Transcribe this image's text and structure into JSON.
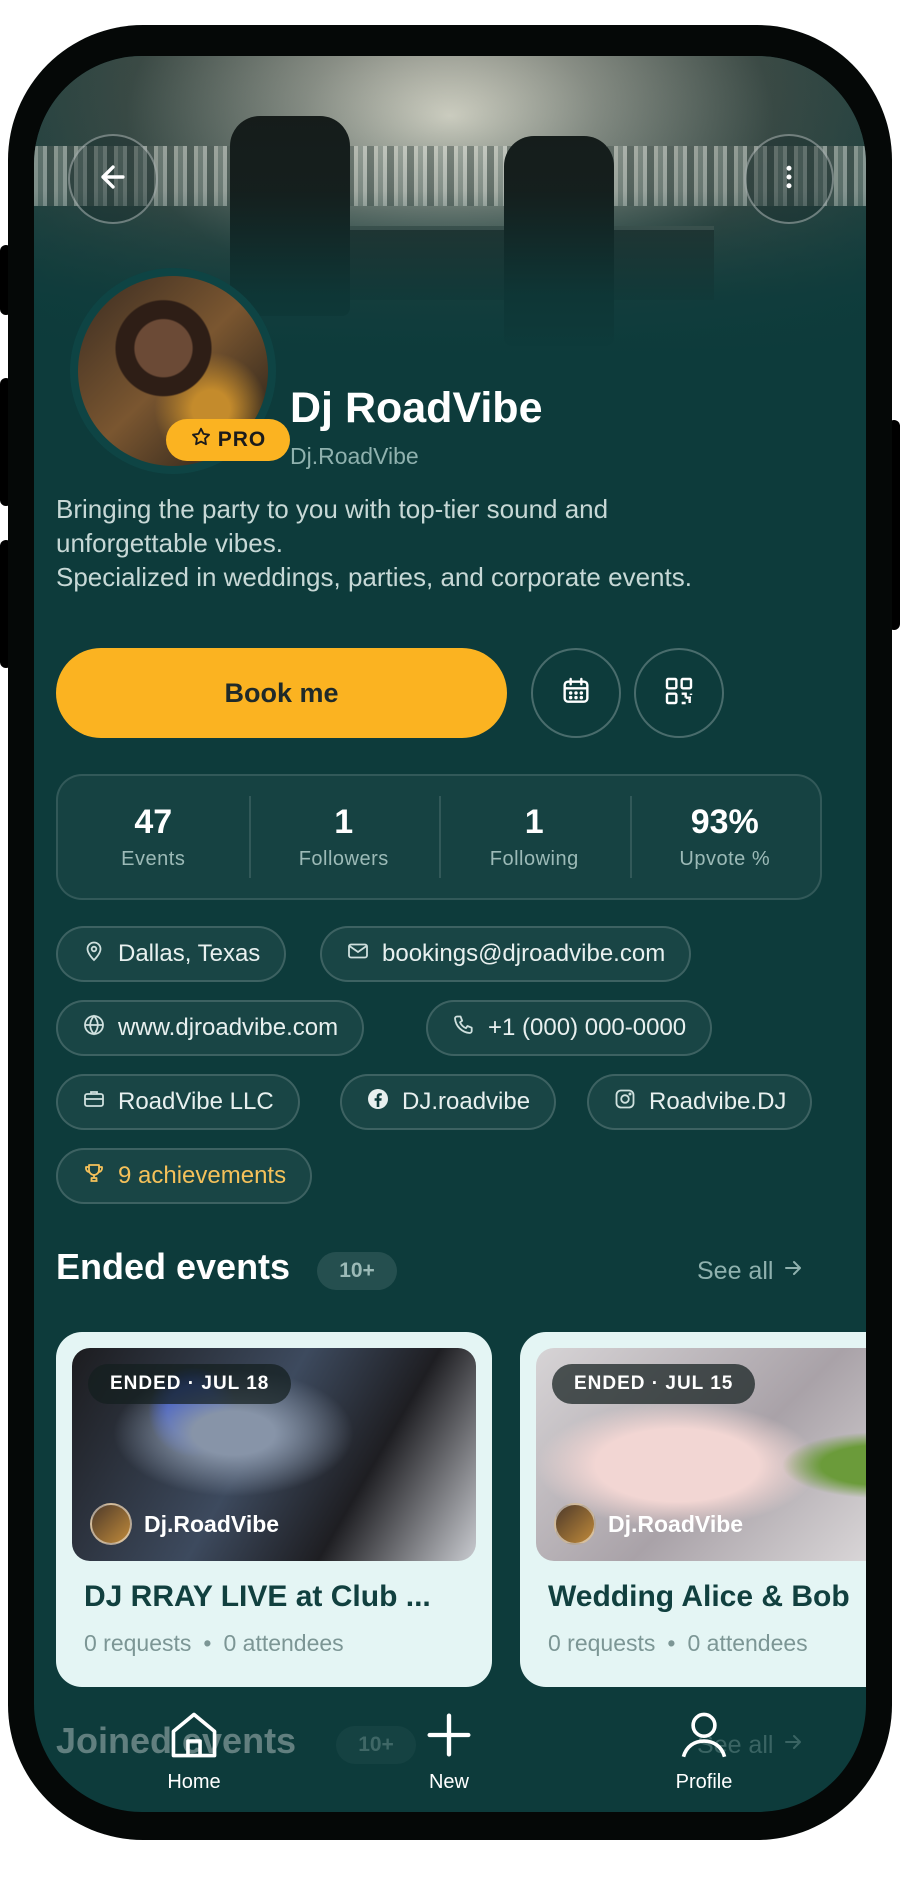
{
  "header": {
    "back_icon": "arrow-left-icon",
    "more_icon": "more-vertical-icon"
  },
  "profile": {
    "badge": "PRO",
    "name": "Dj RoadVibe",
    "handle": "Dj.RoadVibe",
    "bio_lines": [
      "Bringing the party to you with top-tier sound and",
      "unforgettable vibes.",
      "Specialized in weddings, parties, and corporate events."
    ]
  },
  "actions": {
    "book_label": "Book me",
    "calendar_icon": "calendar-icon",
    "qr_icon": "qr-code-icon"
  },
  "stats": [
    {
      "value": "47",
      "label": "Events"
    },
    {
      "value": "1",
      "label": "Followers"
    },
    {
      "value": "1",
      "label": "Following"
    },
    {
      "value": "93%",
      "label": "Upvote %"
    }
  ],
  "chips": {
    "location": "Dallas, Texas",
    "email": "bookings@djroadvibe.com",
    "website": "www.djroadvibe.com",
    "phone": "+1 (000) 000-0000",
    "company": "RoadVibe LLC",
    "facebook": "DJ.roadvibe",
    "instagram": "Roadvibe.DJ",
    "achievements": "9 achievements"
  },
  "ended_events": {
    "title": "Ended events",
    "count": "10+",
    "see_all": "See all",
    "cards": [
      {
        "badge": "ENDED · JUL 18",
        "host": "Dj.RoadVibe",
        "title": "DJ RRAY LIVE at Club ...",
        "requests": "0 requests",
        "attendees": "0 attendees"
      },
      {
        "badge": "ENDED · JUL 15",
        "host": "Dj.RoadVibe",
        "title": "Wedding Alice & Bob",
        "requests": "0 requests",
        "attendees": "0 attendees"
      }
    ]
  },
  "joined_events": {
    "title": "Joined events",
    "count": "10+",
    "see_all": "See all"
  },
  "nav": {
    "home": "Home",
    "new": "New",
    "profile": "Profile"
  },
  "colors": {
    "background": "#0d3b3b",
    "accent": "#fbb321",
    "card": "#e4f5f4"
  }
}
